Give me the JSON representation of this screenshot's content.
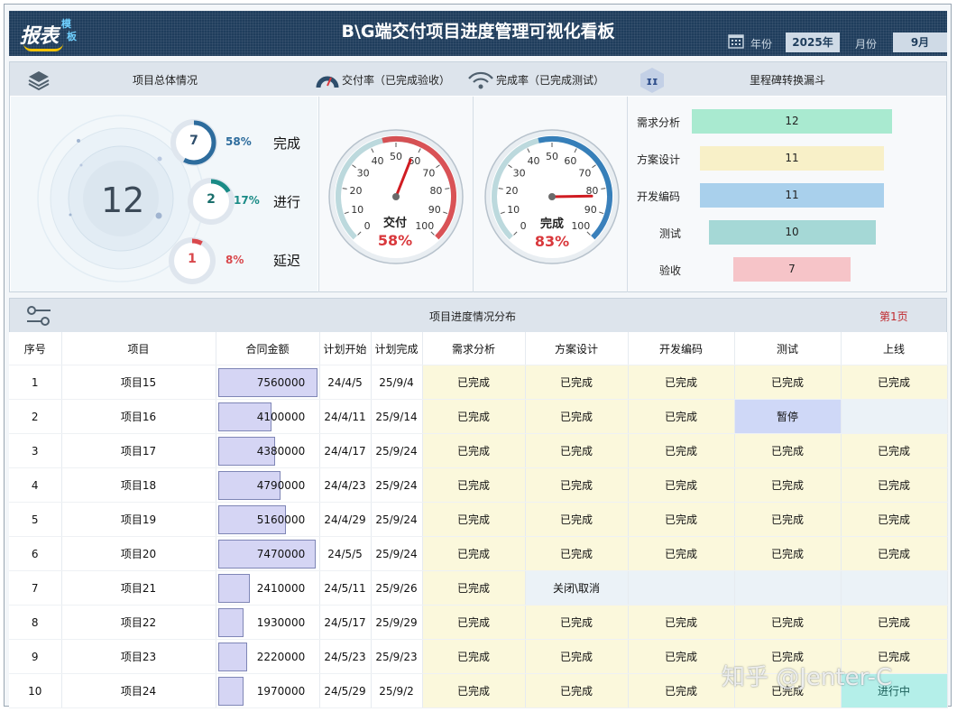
{
  "header": {
    "logo_main": "报表",
    "logo_sub1": "模",
    "logo_sub2": "板",
    "title": "B\\G端交付项目进度管理可视化看板",
    "year_label": "年份",
    "year_value": "2025年",
    "month_label": "月份",
    "month_value": "9月"
  },
  "overview": {
    "title": "项目总体情况",
    "total": "12",
    "items": [
      {
        "count": "7",
        "pct": "58%",
        "label": "完成",
        "color": "#2d6c9d",
        "fraction": 0.58
      },
      {
        "count": "2",
        "pct": "17%",
        "label": "进行",
        "color": "#1a8b86",
        "fraction": 0.17
      },
      {
        "count": "1",
        "pct": "8%",
        "label": "延迟",
        "color": "#d9484c",
        "fraction": 0.08
      }
    ]
  },
  "gauges": [
    {
      "title": "交付率（已完成验收）",
      "label": "交付",
      "pct": "58%",
      "value": 58,
      "color": "#d9383c",
      "icon": "speedometer-icon"
    },
    {
      "title": "完成率（已完成测试）",
      "label": "完成",
      "pct": "83%",
      "value": 83,
      "color": "#1e6fb3",
      "icon": "signal-icon"
    }
  ],
  "gauge_ticks": [
    "0",
    "10",
    "20",
    "30",
    "40",
    "50",
    "60",
    "70",
    "80",
    "90",
    "100"
  ],
  "funnel": {
    "title": "里程碑转换漏斗",
    "stages": [
      {
        "label": "需求分析",
        "value": 12,
        "color": "#a9ead0"
      },
      {
        "label": "方案设计",
        "value": 11,
        "color": "#f8f0c8"
      },
      {
        "label": "开发编码",
        "value": 11,
        "color": "#a9d0ec"
      },
      {
        "label": "测试",
        "value": 10,
        "color": "#a5d8d6"
      },
      {
        "label": "验收",
        "value": 7,
        "color": "#f6c4c8"
      }
    ]
  },
  "progress": {
    "title": "项目进度情况分布",
    "page": "第1页",
    "columns": [
      "序号",
      "项目",
      "合同金额",
      "计划开始",
      "计划完成",
      "需求分析",
      "方案设计",
      "开发编码",
      "测试",
      "上线"
    ],
    "rows": [
      {
        "no": "1",
        "name": "项目15",
        "amount": "7560000",
        "amount_value": 7560000,
        "start": "24/4/5",
        "end": "25/9/4",
        "stages": [
          "已完成",
          "已完成",
          "已完成",
          "已完成",
          "已完成"
        ]
      },
      {
        "no": "2",
        "name": "项目16",
        "amount": "4100000",
        "amount_value": 4100000,
        "start": "24/4/11",
        "end": "25/9/14",
        "stages": [
          "已完成",
          "已完成",
          "已完成",
          "暂停",
          ""
        ]
      },
      {
        "no": "3",
        "name": "项目17",
        "amount": "4380000",
        "amount_value": 4380000,
        "start": "24/4/17",
        "end": "25/9/24",
        "stages": [
          "已完成",
          "已完成",
          "已完成",
          "已完成",
          "已完成"
        ]
      },
      {
        "no": "4",
        "name": "项目18",
        "amount": "4790000",
        "amount_value": 4790000,
        "start": "24/4/23",
        "end": "25/9/24",
        "stages": [
          "已完成",
          "已完成",
          "已完成",
          "已完成",
          "已完成"
        ]
      },
      {
        "no": "5",
        "name": "项目19",
        "amount": "5160000",
        "amount_value": 5160000,
        "start": "24/4/29",
        "end": "25/9/24",
        "stages": [
          "已完成",
          "已完成",
          "已完成",
          "已完成",
          "已完成"
        ]
      },
      {
        "no": "6",
        "name": "项目20",
        "amount": "7470000",
        "amount_value": 7470000,
        "start": "24/5/5",
        "end": "25/9/24",
        "stages": [
          "已完成",
          "已完成",
          "已完成",
          "已完成",
          "已完成"
        ]
      },
      {
        "no": "7",
        "name": "项目21",
        "amount": "2410000",
        "amount_value": 2410000,
        "start": "24/5/11",
        "end": "25/9/26",
        "stages": [
          "已完成",
          "关闭\\取消",
          "",
          "",
          ""
        ]
      },
      {
        "no": "8",
        "name": "项目22",
        "amount": "1930000",
        "amount_value": 1930000,
        "start": "24/5/17",
        "end": "25/9/29",
        "stages": [
          "已完成",
          "已完成",
          "已完成",
          "已完成",
          "已完成"
        ]
      },
      {
        "no": "9",
        "name": "项目23",
        "amount": "2220000",
        "amount_value": 2220000,
        "start": "24/5/23",
        "end": "25/9/23",
        "stages": [
          "已完成",
          "已完成",
          "已完成",
          "已完成",
          "已完成"
        ]
      },
      {
        "no": "10",
        "name": "项目24",
        "amount": "1970000",
        "amount_value": 1970000,
        "start": "24/5/29",
        "end": "25/9/2",
        "stages": [
          "已完成",
          "已完成",
          "已完成",
          "已完成",
          "进行中"
        ]
      }
    ]
  },
  "watermark": "知乎 @Jenter-C",
  "colors": {
    "header_bg": "#1f3d5c",
    "done_cell": "#fbf8dc",
    "pause_cell": "#cfd8f7",
    "progress_cell": "#b4efe9"
  }
}
